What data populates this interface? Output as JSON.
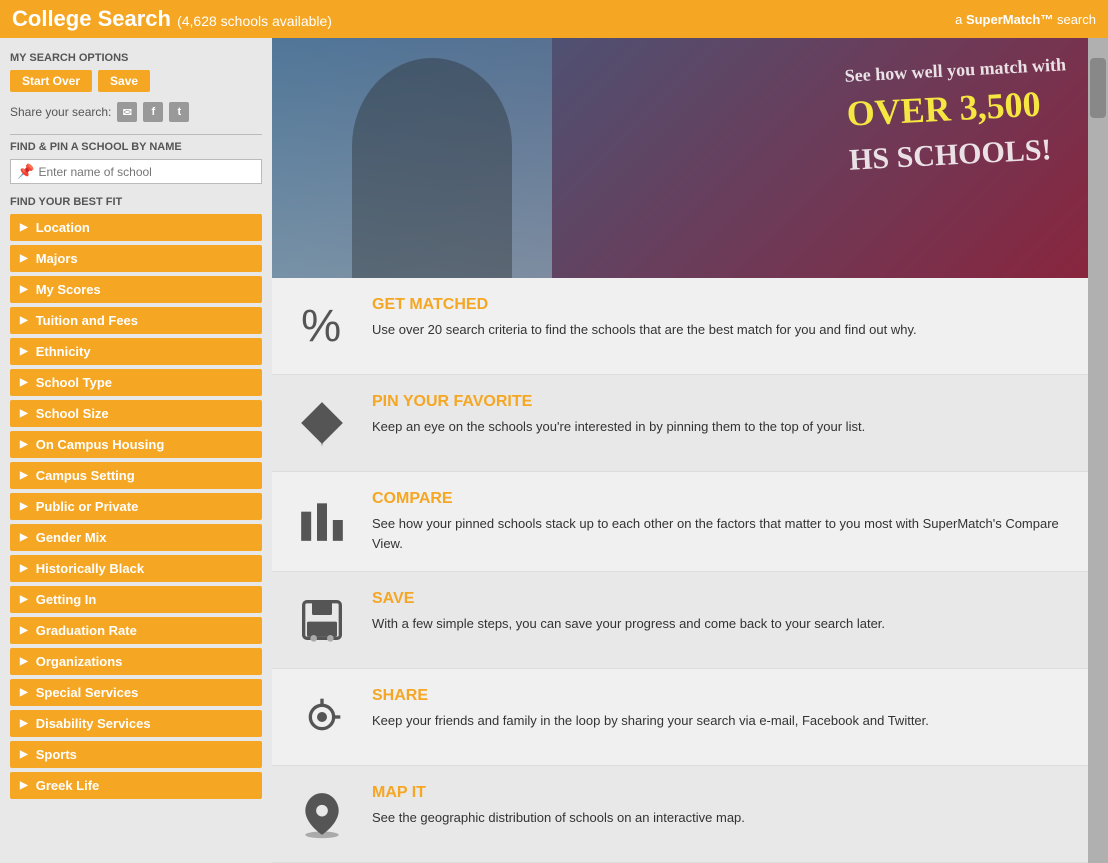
{
  "header": {
    "title": "College Search",
    "subtitle": "(4,628 schools available)",
    "supermatch_label": "a",
    "supermatch_brand": "SuperMatch™",
    "supermatch_suffix": "search"
  },
  "sidebar": {
    "section_my_options": "MY SEARCH OPTIONS",
    "btn_start_over": "Start Over",
    "btn_save": "Save",
    "share_label": "Share your search:",
    "section_find_pin": "FIND & PIN A SCHOOL BY NAME",
    "search_placeholder": "Enter name of school",
    "section_best_fit": "FIND YOUR BEST FIT",
    "filters": [
      "Location",
      "Majors",
      "My Scores",
      "Tuition and Fees",
      "Ethnicity",
      "School Type",
      "School Size",
      "On Campus Housing",
      "Campus Setting",
      "Public or Private",
      "Gender Mix",
      "Historically Black",
      "Getting In",
      "Graduation Rate",
      "Organizations",
      "Special Services",
      "Disability Services",
      "Sports",
      "Greek Life"
    ]
  },
  "hero": {
    "line1": "See how well you match with",
    "line2": "OVER 3,500",
    "line3": "HS SCHOOLS!"
  },
  "features": [
    {
      "id": "get-matched",
      "title": "GET MATCHED",
      "description": "Use over 20 search criteria to find the schools that are the best match for you and find out why.",
      "icon": "percent"
    },
    {
      "id": "pin-favorite",
      "title": "PIN YOUR FAVORITE",
      "description": "Keep an eye on the schools you're interested in by pinning them to the top of your list.",
      "icon": "pin"
    },
    {
      "id": "compare",
      "title": "COMPARE",
      "description": "See how your pinned schools stack up to each other on the factors that matter to you most with SuperMatch's Compare View.",
      "icon": "bars"
    },
    {
      "id": "save",
      "title": "SAVE",
      "description": "With a few simple steps, you can save your progress and come back to your search later.",
      "icon": "save"
    },
    {
      "id": "share",
      "title": "SHARE",
      "description": "Keep your friends and family in the loop by sharing your search via e-mail, Facebook and Twitter.",
      "icon": "share"
    },
    {
      "id": "map-it",
      "title": "MAP IT",
      "description": "See the geographic distribution of schools on an interactive map.",
      "icon": "map"
    }
  ]
}
